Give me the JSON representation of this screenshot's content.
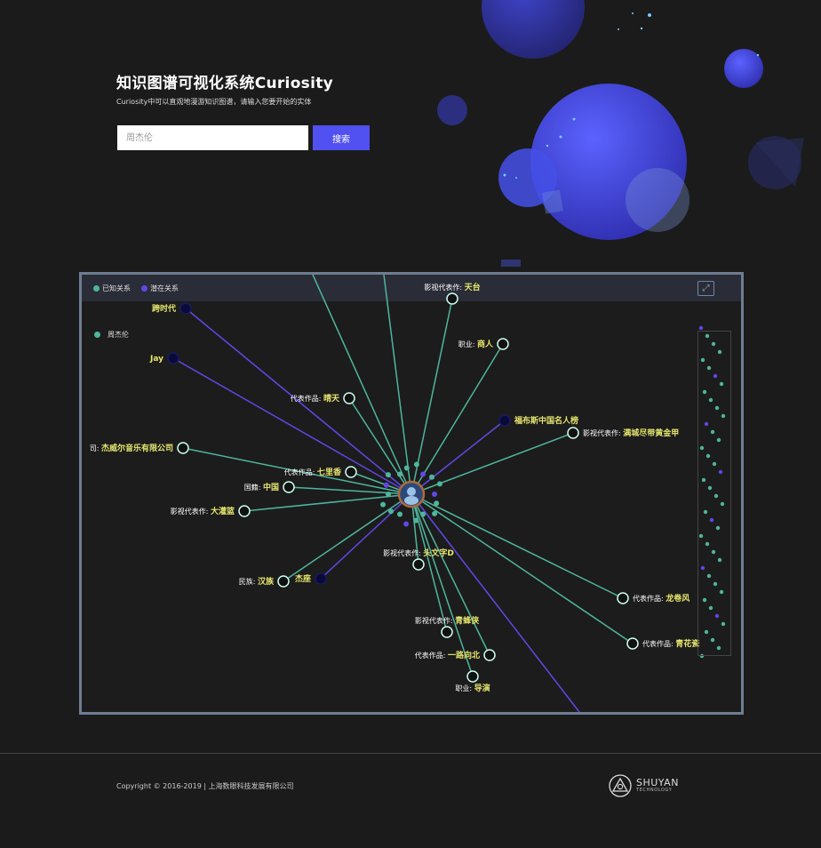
{
  "hero": {
    "title": "知识图谱可视化系统Curiosity",
    "subtitle": "Curiosity中可以直观地漫游知识图谱，请输入您要开始的实体",
    "search_placeholder": "周杰伦",
    "search_button": "搜索"
  },
  "graph": {
    "legend": {
      "known": "已知关系",
      "latent": "潜在关系"
    },
    "entity_filter_label": "周杰伦",
    "expand_icon": "expand-icon",
    "colors": {
      "known": "#4fb69d",
      "latent": "#6048e8",
      "label_key": "#ffffff",
      "label_value": "#e6e66e"
    },
    "center_node": {
      "name": "周杰伦",
      "icon": "avatar"
    },
    "nodes": [
      {
        "key": "影视代表作",
        "value": "天台",
        "relation": "known"
      },
      {
        "key": "职业",
        "value": "商人",
        "relation": "known"
      },
      {
        "key": "",
        "value": "跨时代",
        "relation": "latent"
      },
      {
        "key": "",
        "value": "Jay",
        "relation": "latent"
      },
      {
        "key": "代表作品",
        "value": "晴天",
        "relation": "known"
      },
      {
        "key": "",
        "value": "福布斯中国名人榜",
        "relation": "latent"
      },
      {
        "key": "影视代表作",
        "value": "满城尽带黄金甲",
        "relation": "known"
      },
      {
        "key": "司",
        "value": "杰威尔音乐有限公司",
        "relation": "known"
      },
      {
        "key": "代表作品",
        "value": "七里香",
        "relation": "known"
      },
      {
        "key": "国籍",
        "value": "中国",
        "relation": "known"
      },
      {
        "key": "影视代表作",
        "value": "大灌篮",
        "relation": "known"
      },
      {
        "key": "影视代表作",
        "value": "头文字D",
        "relation": "known"
      },
      {
        "key": "民族",
        "value": "汉族",
        "relation": "known"
      },
      {
        "key": "",
        "value": "杰座",
        "relation": "latent"
      },
      {
        "key": "影视代表作",
        "value": "青蜂侠",
        "relation": "known"
      },
      {
        "key": "代表作品",
        "value": "龙卷风",
        "relation": "known"
      },
      {
        "key": "代表作品",
        "value": "青花瓷",
        "relation": "known"
      },
      {
        "key": "代表作品",
        "value": "一路向北",
        "relation": "known"
      },
      {
        "key": "职业",
        "value": "导演",
        "relation": "known"
      }
    ]
  },
  "footer": {
    "copyright": "Copyright © 2016-2019 | 上海数眼科技发展有限公司",
    "brand_name": "SHUYAN",
    "brand_tagline": "TECHNOLOGY"
  }
}
